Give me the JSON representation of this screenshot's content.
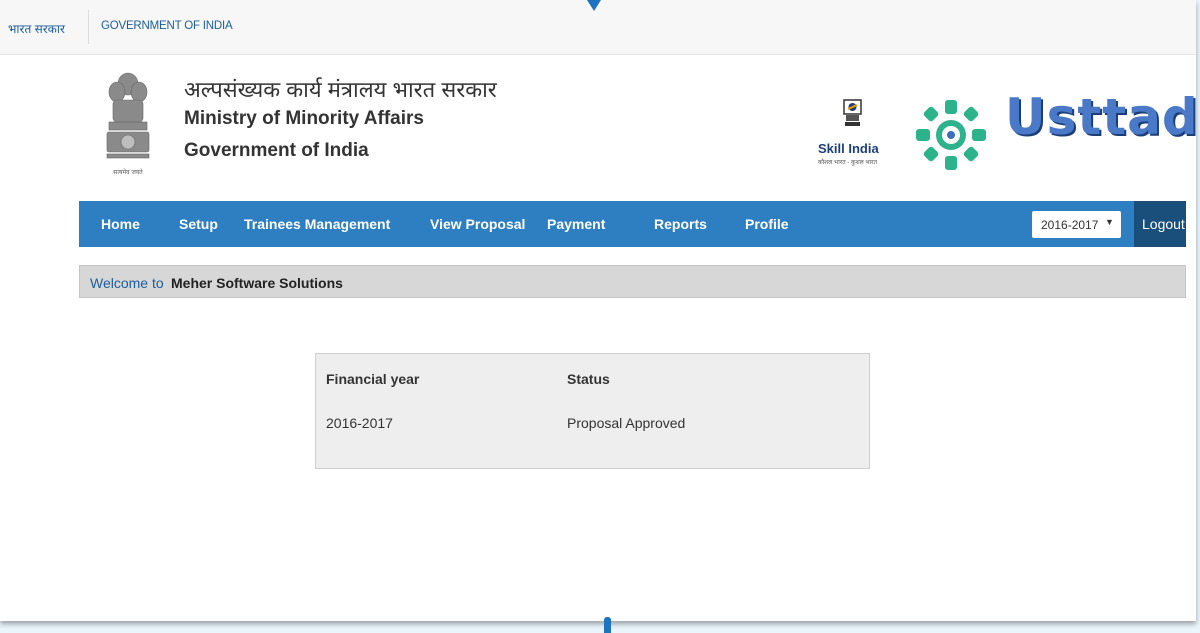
{
  "gov_bar": {
    "hindi": "भारत सरकार",
    "english": "GOVERNMENT OF INDIA"
  },
  "header": {
    "ministry_hindi": "अल्पसंख्यक कार्य मंत्रालय भारत सरकार",
    "ministry_english": "Ministry of Minority Affairs",
    "government": "Government of India",
    "emblem_motto": "सत्यमेव जयते",
    "skill_india": "Skill India",
    "skill_india_tagline": "कौशल भारत - कुशल भारत",
    "usttad": "Usttad"
  },
  "nav": {
    "items": [
      "Home",
      "Setup",
      "Trainees Management",
      "View Proposal",
      "Payment",
      "Reports",
      "Profile"
    ],
    "year_selected": "2016-2017",
    "logout": "Logout"
  },
  "welcome": {
    "label": "Welcome to",
    "organization": "Meher Software Solutions"
  },
  "status_table": {
    "headers": [
      "Financial year",
      "Status"
    ],
    "rows": [
      [
        "2016-2017",
        "Proposal Approved"
      ]
    ]
  },
  "colors": {
    "nav_blue": "#2e7fc1",
    "logout_dark": "#1a4f7c",
    "link_blue": "#1c5d9c"
  }
}
